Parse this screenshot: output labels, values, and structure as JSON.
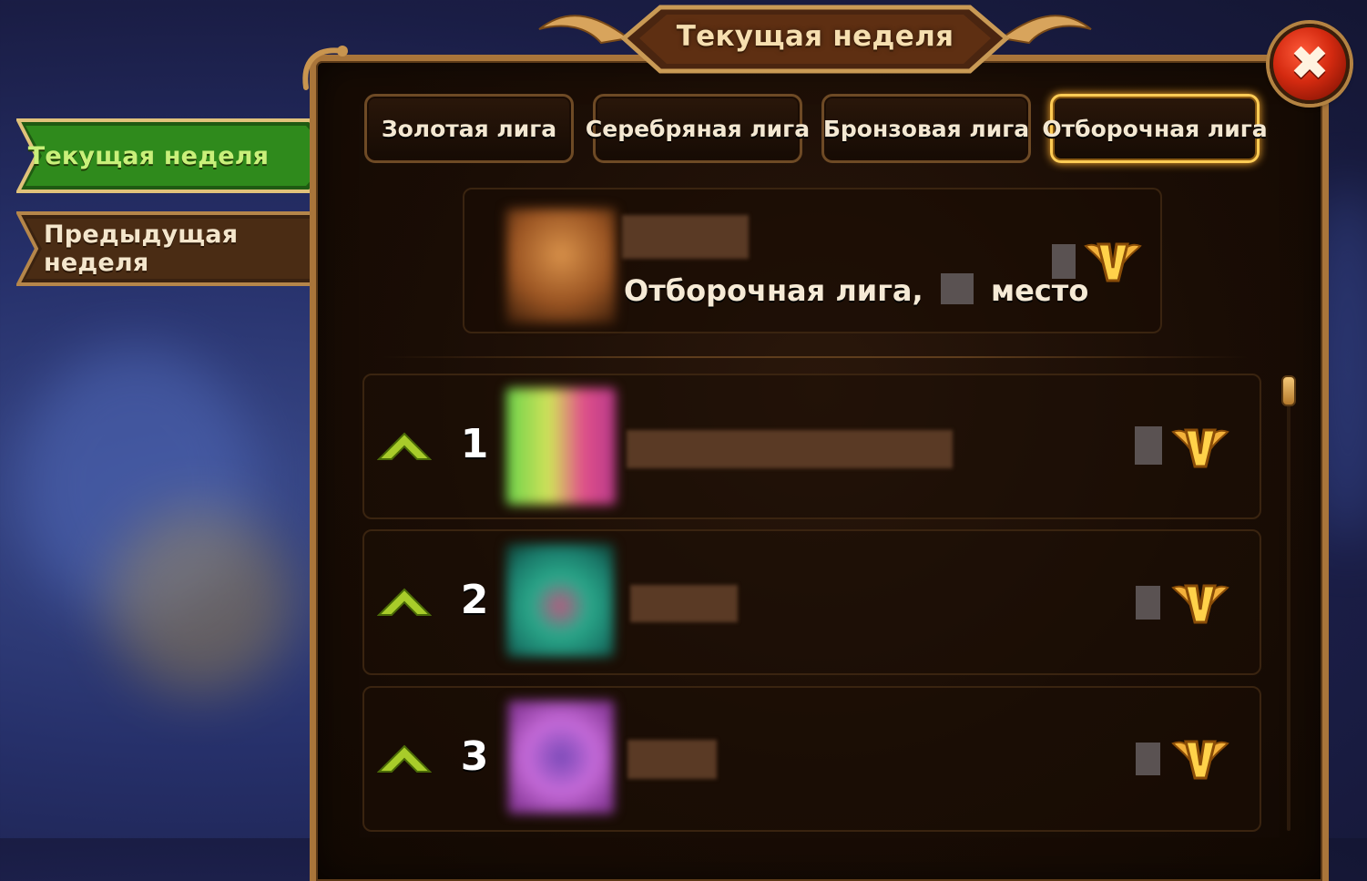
{
  "header": {
    "title": "Текущая неделя"
  },
  "side_tabs": [
    {
      "label": "Текущая неделя",
      "active": true
    },
    {
      "label": "Предыдущая неделя",
      "active": false
    }
  ],
  "league_tabs": [
    {
      "label": "Золотая лига",
      "active": false
    },
    {
      "label": "Серебряная лига",
      "active": false
    },
    {
      "label": "Бронзовая лига",
      "active": false
    },
    {
      "label": "Отборочная лига",
      "active": true
    }
  ],
  "my_card": {
    "league_prefix": "Отборочная лига,",
    "place_suffix": "место",
    "icon": "v-wings-emblem-icon"
  },
  "rows": [
    {
      "rank": "1",
      "trend_icon": "arrow-up-icon",
      "emblem_icon": "v-wings-emblem-icon"
    },
    {
      "rank": "2",
      "trend_icon": "arrow-up-icon",
      "emblem_icon": "v-wings-emblem-icon"
    },
    {
      "rank": "3",
      "trend_icon": "arrow-up-icon",
      "emblem_icon": "v-wings-emblem-icon"
    }
  ],
  "close_button": {
    "icon": "close-icon",
    "glyph": "✖"
  },
  "colors": {
    "accent_green": "#c9f07a",
    "gold": "#ffcc55",
    "frame": "#a9753a",
    "close_red": "#d42a10"
  }
}
